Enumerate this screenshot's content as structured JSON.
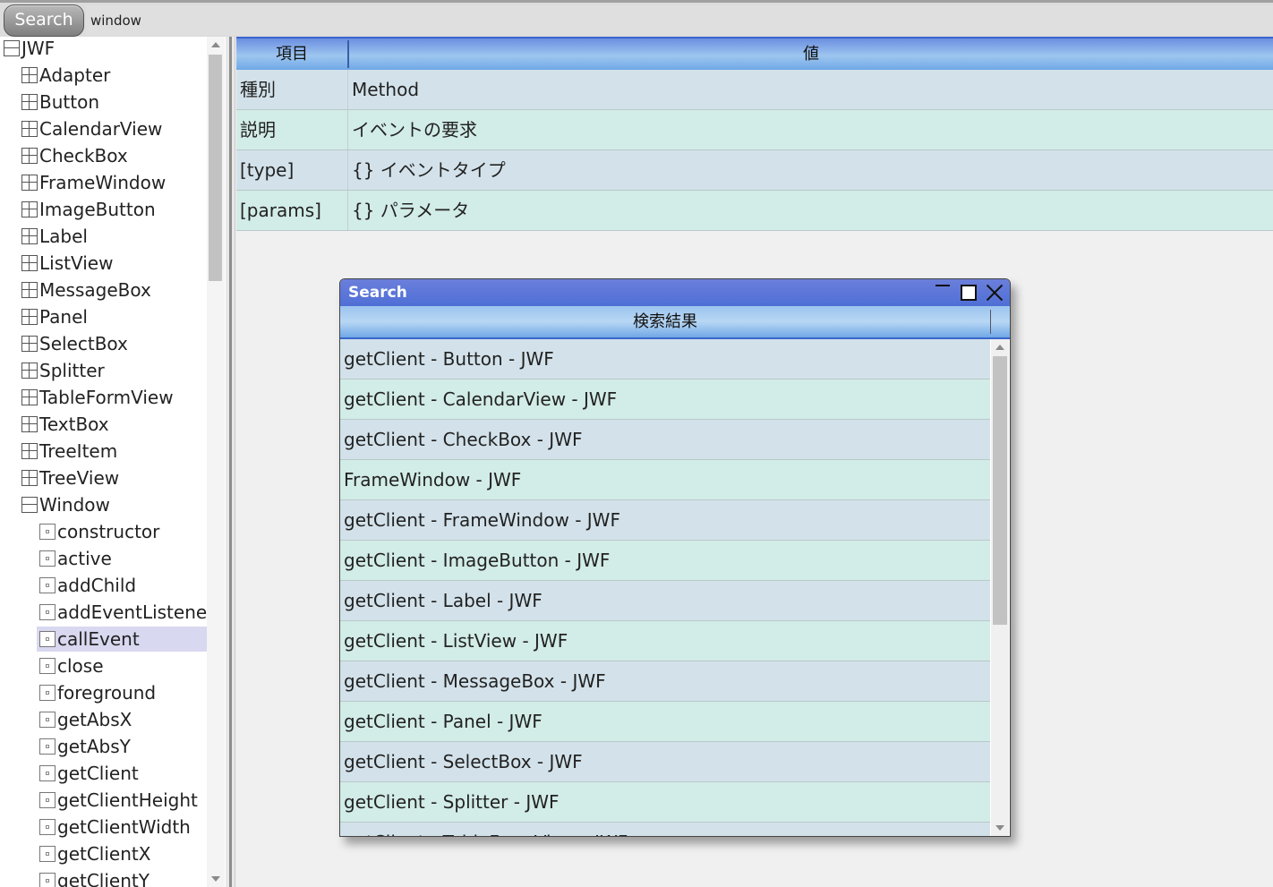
{
  "search": {
    "button_label": "Search",
    "input_value": "window"
  },
  "tree": {
    "root": "JWF",
    "classes": [
      "Adapter",
      "Button",
      "CalendarView",
      "CheckBox",
      "FrameWindow",
      "ImageButton",
      "Label",
      "ListView",
      "MessageBox",
      "Panel",
      "SelectBox",
      "Splitter",
      "TableFormView",
      "TextBox",
      "TreeItem",
      "TreeView"
    ],
    "expanded_class": "Window",
    "members": [
      "constructor",
      "active",
      "addChild",
      "addEventListener",
      "callEvent",
      "close",
      "foreground",
      "getAbsX",
      "getAbsY",
      "getClient",
      "getClientHeight",
      "getClientWidth",
      "getClientX",
      "getClientY"
    ],
    "selected_member": "callEvent"
  },
  "detail": {
    "headers": {
      "key": "項目",
      "value": "値"
    },
    "rows": [
      {
        "key": "種別",
        "value": "Method"
      },
      {
        "key": "説明",
        "value": "イベントの要求"
      },
      {
        "key": "[type]",
        "value": "{} イベントタイプ"
      },
      {
        "key": "[params]",
        "value": "{} パラメータ"
      }
    ]
  },
  "search_window": {
    "title": "Search",
    "column_header": "検索結果",
    "results": [
      "getClient - Button - JWF",
      "getClient - CalendarView - JWF",
      "getClient - CheckBox - JWF",
      "FrameWindow - JWF",
      "getClient - FrameWindow - JWF",
      "getClient - ImageButton - JWF",
      "getClient - Label - JWF",
      "getClient - ListView - JWF",
      "getClient - MessageBox - JWF",
      "getClient - Panel - JWF",
      "getClient - SelectBox - JWF",
      "getClient - Splitter - JWF",
      "getClient - TableFormView - JWF"
    ]
  },
  "colors": {
    "title_bar": "#5b76d8",
    "row_odd": "#d3e2ea",
    "row_even": "#d2ece7",
    "selected": "#d8d8f0"
  }
}
